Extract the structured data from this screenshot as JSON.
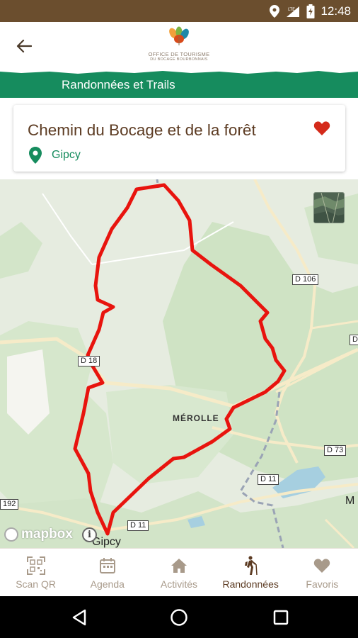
{
  "status_bar": {
    "time": "12:48",
    "network_label": "LTE",
    "icons": [
      "location-icon",
      "signal-icon",
      "battery-icon"
    ],
    "background_color": "#6b4e2e"
  },
  "header": {
    "back_icon": "arrow-left-icon",
    "logo": {
      "line1": "OFFICE DE TOURISME",
      "line2": "DU BOCAGE BOURBONNAIS"
    }
  },
  "banner": {
    "title": "Randonnées et Trails",
    "color": "#168c5e"
  },
  "trail": {
    "title": "Chemin du Bocage et de la forêt",
    "location": "Gipcy",
    "favorite_icon": "heart-icon",
    "favorite_color": "#d42a1a",
    "title_color": "#5c3b22"
  },
  "map": {
    "road_labels": [
      "D 106",
      "D 18",
      "D 73",
      "D 11",
      "D 11",
      "192",
      "D"
    ],
    "town_labels": [
      "MÉROLLE",
      "Gipcy",
      "M"
    ],
    "attribution": "mapbox",
    "info_label": "i",
    "route_color": "#e8140e",
    "satellite_toggle_icon": "satellite-layer-icon"
  },
  "bottom_nav": {
    "items": [
      {
        "label": "Scan QR",
        "icon": "qr-code-icon",
        "active": false
      },
      {
        "label": "Agenda",
        "icon": "calendar-icon",
        "active": false
      },
      {
        "label": "Activités",
        "icon": "home-icon",
        "active": false
      },
      {
        "label": "Randonnées",
        "icon": "hiker-icon",
        "active": true
      },
      {
        "label": "Favoris",
        "icon": "heart-icon",
        "active": false
      }
    ]
  },
  "system_nav": {
    "buttons": [
      "back-triangle-icon",
      "home-circle-icon",
      "recents-square-icon"
    ]
  }
}
